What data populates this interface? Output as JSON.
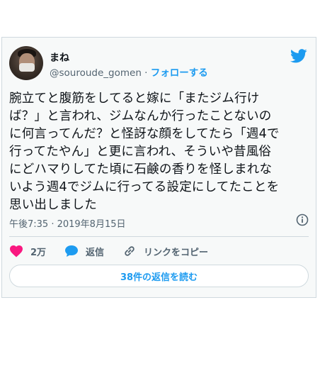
{
  "tweet": {
    "name": "まね",
    "handle": "@souroude_gomen",
    "separator": " · ",
    "follow_label": "フォローする",
    "text": "腕立てと腹筋をしてると嫁に「またジム行け\nば？」と言われ、ジムなんか行ったことないの\nに何言ってんだ？と怪訝な顔をしてたら「週4で\n行ってたやん」と更に言われ、そういや昔風俗\nにどハマりしてた頃に石鹸の香りを怪しまれな\nいよう週4でジムに行ってる設定にしてたことを\n思い出しました",
    "timestamp": "午後7:35 · 2019年8月15日"
  },
  "actions": {
    "like_count": "2万",
    "reply_label": "返信",
    "copy_link_label": "リンクをコピー"
  },
  "read_replies_label": "38件の返信を読む",
  "colors": {
    "accent": "#1d9bf0",
    "like": "#f91880",
    "muted": "#536471",
    "border": "#cfd9de"
  },
  "icons": {
    "brand": "twitter-bird-icon",
    "info": "info-icon",
    "like": "heart-icon",
    "reply": "speech-bubble-icon",
    "link": "link-icon"
  }
}
